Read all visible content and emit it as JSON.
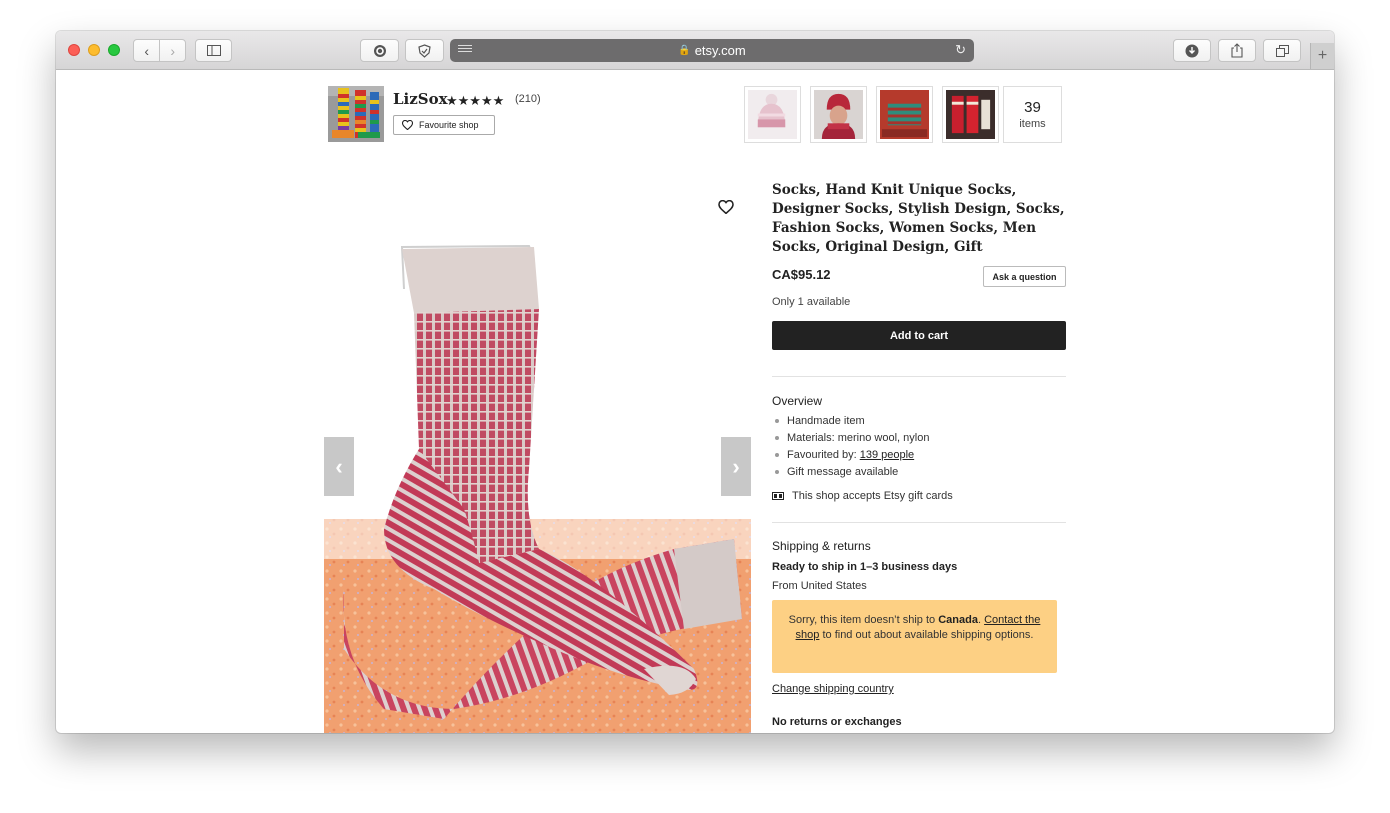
{
  "browser": {
    "url": "etsy.com"
  },
  "shop": {
    "name": "LizSox",
    "stars": "★★★★★",
    "review_count": "(210)",
    "favourite_label": "Favourite shop",
    "items_count": "39",
    "items_label": "items"
  },
  "listing": {
    "title": "Socks, Hand Knit Unique Socks, Designer Socks, Stylish Design, Socks, Fashion Socks, Women Socks, Men Socks, Original Design, Gift",
    "price": "CA$95.12",
    "ask_label": "Ask a question",
    "availability": "Only 1 available",
    "cart_label": "Add to cart"
  },
  "overview": {
    "heading": "Overview",
    "items": [
      {
        "text": "Handmade item"
      },
      {
        "text": "Materials: merino wool, nylon"
      },
      {
        "text": "Favourited by:",
        "link": "139 people"
      },
      {
        "text": "Gift message available"
      }
    ],
    "gift_cards": "This shop accepts Etsy gift cards"
  },
  "shipping": {
    "heading": "Shipping & returns",
    "ready": "Ready to ship in 1–3 business days",
    "from": "From United States",
    "notice_pre": "Sorry, this item doesn’t ship to ",
    "notice_country": "Canada",
    "notice_mid": ". ",
    "notice_link": "Contact the shop",
    "notice_post": " to find out about available shipping options.",
    "change_country": "Change shipping country",
    "no_returns": "No returns or exchanges"
  },
  "colors": {
    "cart_button": "#222222",
    "notice_bg": "#fdd084"
  }
}
